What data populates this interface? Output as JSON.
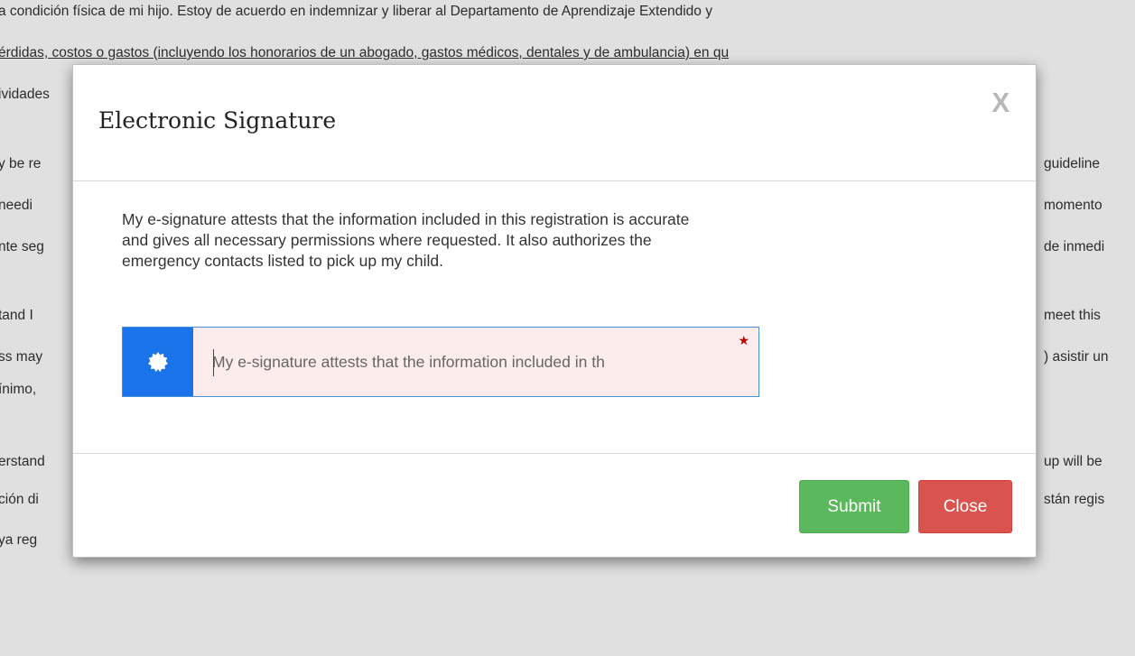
{
  "background": {
    "lines": [
      {
        "text": "a condición física de mi hijo. Estoy de acuerdo en indemnizar y liberar al Departamento de Aprendizaje Extendido y",
        "underline": false
      },
      {
        "text": "érdidas, costos o gastos (incluyendo los honorarios de un abogado, gastos médicos, dentales y de ambulancia) en qu",
        "underline": true
      },
      {
        "text": "ividades",
        "underline": false
      }
    ],
    "left_fragments": [
      "y be re",
      "needi",
      "nte seg",
      "tand I",
      "ss may",
      "ínimo,",
      "erstand",
      "ción di",
      "ya reg"
    ],
    "right_fragments": [
      "guideline",
      "momento",
      "de inmedi",
      "meet this",
      ") asistir un",
      "up will be",
      "stán regis"
    ]
  },
  "modal": {
    "title": "Electronic Signature",
    "close_label": "X",
    "attestation": "My e-signature attests that the information included in this registration is accurate and gives all necessary permissions where requested. It also authorizes the emergency contacts listed to pick up my child.",
    "signature": {
      "icon": "badge-icon",
      "placeholder": "My e-signature attests that the information included in th",
      "value": "",
      "required": true,
      "required_mark": "★"
    },
    "buttons": {
      "submit_label": "Submit",
      "close_label": "Close"
    }
  },
  "colors": {
    "submit": "#5cb85c",
    "close": "#d9534f",
    "addon": "#1a73e8",
    "field_bg": "#fdecec",
    "required_star": "#b30000"
  }
}
